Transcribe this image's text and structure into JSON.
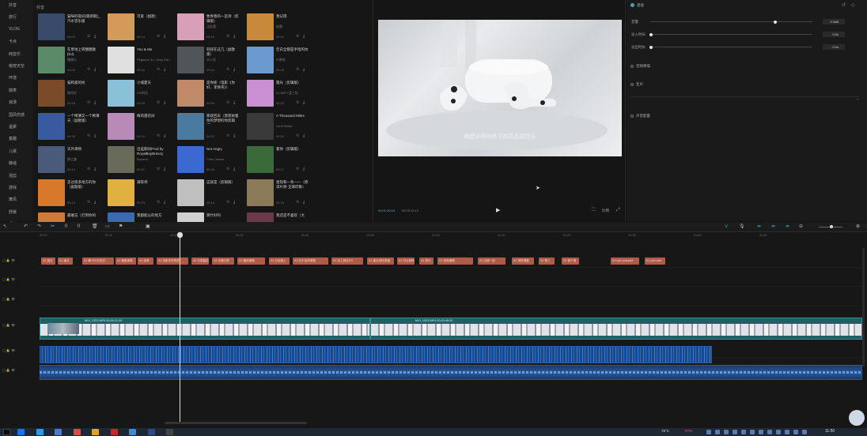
{
  "sidebar": {
    "items": [
      "抖音",
      "旅行",
      "VLOG",
      "卡点",
      "纯音乐",
      "萌宠天空",
      "环境",
      "搞笑",
      "浪漫",
      "国风伤感",
      "温柔",
      "童趣",
      "儿歌",
      "静谧",
      "混剪",
      "游戏",
      "舞风",
      "舒缓",
      "轻快"
    ]
  },
  "library": {
    "header": "抖音",
    "cards": [
      {
        "title": "猫咪的夜间(随即期)_汽水音乐版",
        "artist": "",
        "dur": "00:23",
        "color": "#3a4a6a"
      },
      {
        "title": "可爱（副歌）",
        "artist": "",
        "dur": "00:14",
        "color": "#d49a5a"
      },
      {
        "title": "致青春的一首诗（剪辑版）",
        "artist": "汉金喜",
        "dur": "00:19",
        "color": "#d8a0b8"
      },
      {
        "title": "我记得",
        "artist": "赵雷",
        "dur": "00:31",
        "color": "#c8893a"
      },
      {
        "title": "在草地上转圈圈跳(DJ)",
        "artist": "魏晓乐",
        "dur": "00:20",
        "color": "#5a8a6a"
      },
      {
        "title": "You & Me",
        "artist": "Pegasus Xu, Jinny Dang",
        "dur": "00:16",
        "color": "#e0e0e0"
      },
      {
        "title": "轻轻在这几（副歌版）",
        "artist": "木小亚",
        "dur": "00:24",
        "color": "#50555a"
      },
      {
        "title": "告白全都是手指的纹",
        "artist": "叶晓芸",
        "dur": "00:15",
        "color": "#6a9ad0"
      },
      {
        "title": "猫和爱的纹",
        "artist": "周杰伦",
        "dur": "00:18",
        "color": "#7a4a2a"
      },
      {
        "title": "小城夏天",
        "artist": "LBI利比",
        "dur": "00:18",
        "color": "#8ac0d8"
      },
      {
        "title": "是你呢（电影《你好，李焕英》）",
        "artist": "",
        "dur": "00:29",
        "color": "#c08a6a"
      },
      {
        "title": "霞光（剪辑版）",
        "artist": "ILLIMIT+蓝三钻",
        "dur": "00:23",
        "color": "#c890d0"
      },
      {
        "title": "一个稀薄又一个稀薄天（副歌版）",
        "artist": "",
        "dur": "00:18",
        "color": "#3a5aa0"
      },
      {
        "title": "梅风遇花间",
        "artist": "",
        "dur": "00:19",
        "color": "#b88ab8"
      },
      {
        "title": "那就回去（悠悠依着你的梦想的你剪辑版）",
        "artist": "",
        "dur": "00:31",
        "color": "#4a7aa0"
      },
      {
        "title": "A Thousand Miles",
        "artist": "Jordi Santa",
        "dur": "00:20",
        "color": "#3a3a3a"
      },
      {
        "title": "天外来物",
        "artist": "薛之谦",
        "dur": "00:14",
        "color": "#4a5a7a"
      },
      {
        "title": "出差期间Prod by RoyalBoyBreezy",
        "artist": "Bunana",
        "dur": "00:21",
        "color": "#6a6a5a"
      },
      {
        "title": "Not Angry",
        "artist": "Chris James",
        "dur": "00:25",
        "color": "#3a6ad0"
      },
      {
        "title": "着你（剪辑版）",
        "artist": "",
        "dur": "00:17",
        "color": "#3a6a3a"
      },
      {
        "title": "走过很多地方的你（副歌版）",
        "artist": "",
        "dur": "00:13",
        "color": "#d8782a"
      },
      {
        "title": "满等待",
        "artist": "",
        "dur": "00:23",
        "color": "#e0b040"
      },
      {
        "title": "这就是（剪辑版）",
        "artist": "",
        "dur": "00:14",
        "color": "#c0c0c0"
      },
      {
        "title": "星际和一条——（原谅片原-全球印象）",
        "artist": "",
        "dur": "00:23",
        "color": "#8a7a5a"
      },
      {
        "title": "最难忘（打到你的",
        "artist": "",
        "dur": "",
        "color": "#d07a3a"
      },
      {
        "title": "我都能以的地方",
        "artist": "",
        "dur": "",
        "color": "#3a6ab0"
      },
      {
        "title": "阴什好吗",
        "artist": "",
        "dur": "",
        "color": "#d0d0d0"
      },
      {
        "title": "我还是不喜欢（大",
        "artist": "",
        "dur": "",
        "color": "#6a3a4a"
      }
    ]
  },
  "preview": {
    "subtitle": "畅想多种场景下的高品质音乐",
    "time_current": "00:01:00:24",
    "time_total": "00:03:15:13",
    "ratio_label": "比例"
  },
  "props": {
    "section": "基础",
    "rows": [
      {
        "label": "音量",
        "value": "0.0dB"
      },
      {
        "label": "淡入时长",
        "value": "0.0s"
      },
      {
        "label": "淡出时长",
        "value": "0.0s"
      }
    ],
    "toggles": [
      "音频降噪",
      "变声",
      "声音配置"
    ]
  },
  "ruler": {
    "labels": [
      "00:00",
      "00:10",
      "00:20",
      "00:30",
      "00:40",
      "00:50",
      "01:00",
      "01:10",
      "01:20",
      "01:30",
      "01:40",
      "01:50"
    ]
  },
  "text_clips": [
    "A1 高月",
    "A1 逢日",
    "A1 腾·200元测试",
    "A1 偏高单数",
    "A1 续单",
    "A1 电影多彩物质",
    "A1 分割监控",
    "A1 乐器分类",
    "A1 播放编辑",
    "A1 对话拖入",
    "A1 对于品质调整",
    "A1 加上测试5.5",
    "A1 重合线性表格",
    "A1 可以转换",
    "A1 提示",
    "A1 语音编辑",
    "A1 边缘一起",
    "A1 测样调整",
    "A1 第三",
    "A1 客户端",
    "A1 lyric.autopilot",
    "A1 lyric.add"
  ],
  "video_clips": [
    {
      "label": "MVI_1322.MP4   00:00:21:20"
    },
    {
      "label": "MVI_1323.MP4   00:00:48:20"
    }
  ],
  "taskbar": {
    "temp": "76°C",
    "cpu": "97%",
    "time": "11:50"
  }
}
